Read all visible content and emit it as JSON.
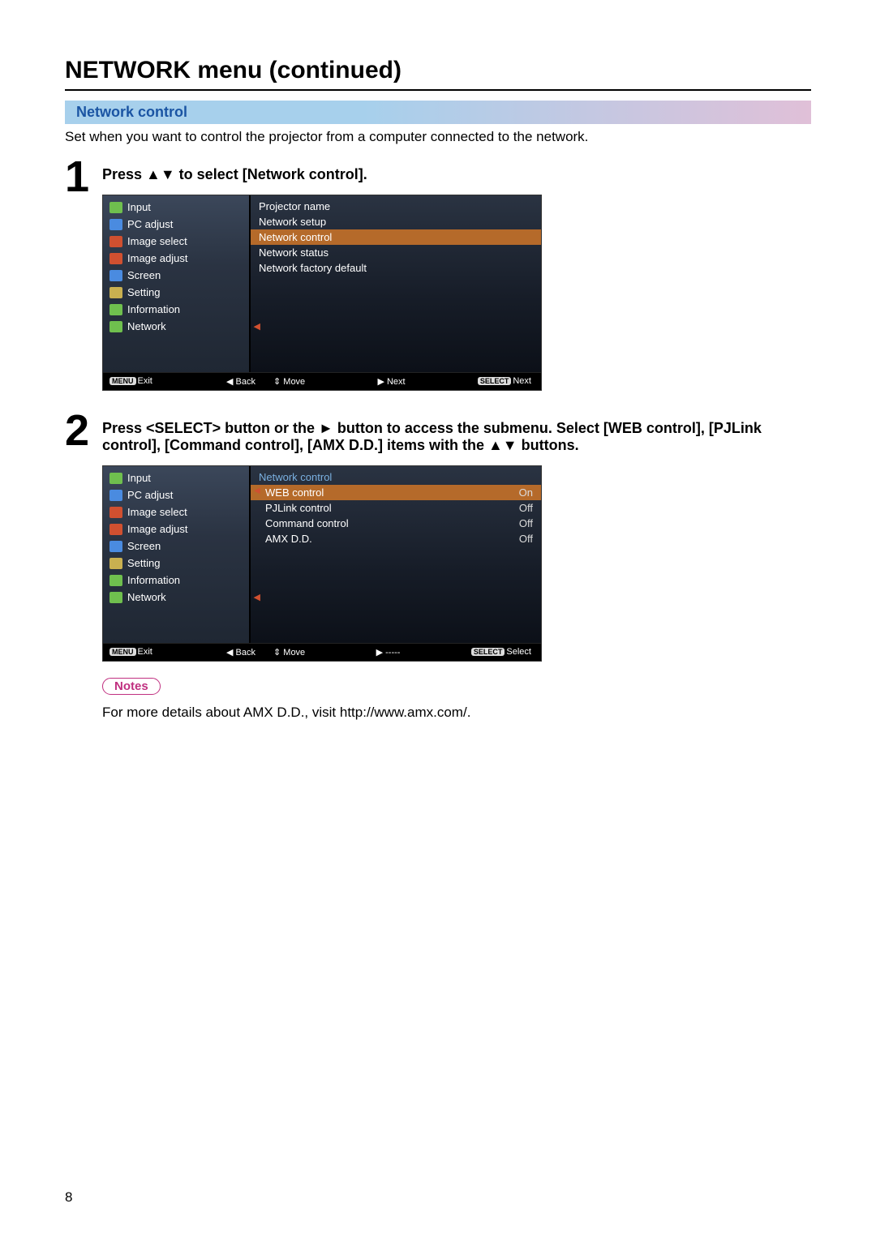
{
  "page": {
    "title": "NETWORK menu (continued)",
    "number": "8"
  },
  "section": {
    "header": "Network control",
    "intro": "Set when you want to control the projector from a computer connected to the network."
  },
  "step1": {
    "number": "1",
    "instruction": "Press ▲▼ to select [Network control].",
    "osd": {
      "sidebar": [
        {
          "label": "Input"
        },
        {
          "label": "PC adjust"
        },
        {
          "label": "Image select"
        },
        {
          "label": "Image adjust"
        },
        {
          "label": "Screen"
        },
        {
          "label": "Setting"
        },
        {
          "label": "Information"
        },
        {
          "label": "Network",
          "selected": true
        }
      ],
      "main": [
        {
          "label": "Projector name"
        },
        {
          "label": "Network setup"
        },
        {
          "label": "Network control",
          "highlight": true
        },
        {
          "label": "Network status"
        },
        {
          "label": "Network factory default"
        }
      ],
      "footer": {
        "left": {
          "menu_key": "MENU",
          "exit": "Exit",
          "back_arrow": "◀",
          "back": "Back"
        },
        "right": {
          "move_arrow": "⇕",
          "move": "Move",
          "next_arrow": "▶",
          "next": "Next",
          "select_key": "SELECT",
          "select": "Next"
        }
      }
    }
  },
  "step2": {
    "number": "2",
    "instruction": "Press <SELECT> button or the ► button to access the submenu. Select [WEB control], [PJLink control], [Command control], [AMX D.D.] items with the ▲▼ buttons.",
    "osd": {
      "sidebar": [
        {
          "label": "Input"
        },
        {
          "label": "PC adjust"
        },
        {
          "label": "Image select"
        },
        {
          "label": "Image adjust"
        },
        {
          "label": "Screen"
        },
        {
          "label": "Setting"
        },
        {
          "label": "Information"
        },
        {
          "label": "Network",
          "selected": true
        }
      ],
      "main_header": "Network control",
      "main": [
        {
          "label": "WEB control",
          "value": "On",
          "highlight": true
        },
        {
          "label": "PJLink control",
          "value": "Off"
        },
        {
          "label": "Command control",
          "value": "Off"
        },
        {
          "label": "AMX D.D.",
          "value": "Off"
        }
      ],
      "footer": {
        "left": {
          "menu_key": "MENU",
          "exit": "Exit",
          "back_arrow": "◀",
          "back": "Back"
        },
        "right": {
          "move_arrow": "⇕",
          "move": "Move",
          "next_arrow": "▶",
          "next": "-----",
          "select_key": "SELECT",
          "select": "Select"
        }
      }
    }
  },
  "notes": {
    "label": "Notes",
    "text": "For more details about AMX D.D., visit http://www.amx.com/."
  }
}
